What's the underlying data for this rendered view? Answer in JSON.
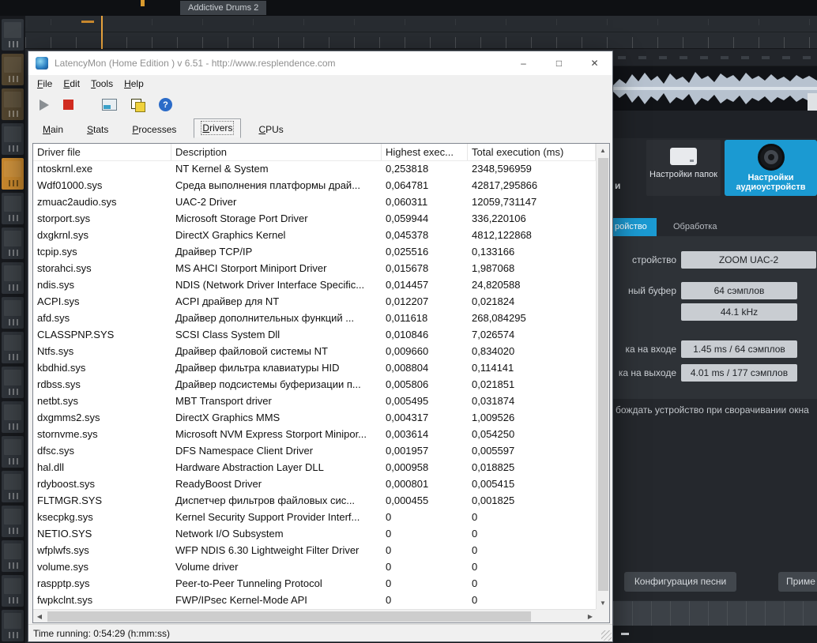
{
  "colors": {
    "accent_blue": "#1b9ad2",
    "stop_red": "#d02b20",
    "amber": "#c8882e"
  },
  "window": {
    "title": "LatencyMon  (Home Edition )  v 6.51 - http://www.resplendence.com",
    "caption_buttons": {
      "minimize": "–",
      "maximize": "□",
      "close": "✕"
    },
    "menu": [
      "File",
      "Edit",
      "Tools",
      "Help"
    ],
    "toolbar": {
      "icons": [
        "play-icon",
        "stop-icon",
        "report-icon",
        "copy-icon",
        "help-icon"
      ],
      "help_glyph": "?"
    },
    "tabs": [
      {
        "label": "Main",
        "active": false
      },
      {
        "label": "Stats",
        "active": false
      },
      {
        "label": "Processes",
        "active": false
      },
      {
        "label": "Drivers",
        "active": true
      },
      {
        "label": "CPUs",
        "active": false
      }
    ],
    "table": {
      "columns": [
        "Driver file",
        "Description",
        "Highest exec...",
        "Total execution (ms)"
      ],
      "rows": [
        [
          "ntoskrnl.exe",
          "NT Kernel & System",
          "0,253818",
          "2348,596959"
        ],
        [
          "Wdf01000.sys",
          "Среда выполнения платформы драй...",
          "0,064781",
          "42817,295866"
        ],
        [
          "zmuac2audio.sys",
          "UAC-2 Driver",
          "0,060311",
          "12059,731147"
        ],
        [
          "storport.sys",
          "Microsoft Storage Port Driver",
          "0,059944",
          "336,220106"
        ],
        [
          "dxgkrnl.sys",
          "DirectX Graphics Kernel",
          "0,045378",
          "4812,122868"
        ],
        [
          "tcpip.sys",
          "Драйвер TCP/IP",
          "0,025516",
          "0,133166"
        ],
        [
          "storahci.sys",
          "MS AHCI Storport Miniport Driver",
          "0,015678",
          "1,987068"
        ],
        [
          "ndis.sys",
          "NDIS (Network Driver Interface Specific...",
          "0,014457",
          "24,820588"
        ],
        [
          "ACPI.sys",
          "ACPI драйвер для NT",
          "0,012207",
          "0,021824"
        ],
        [
          "afd.sys",
          "Драйвер дополнительных функций ...",
          "0,011618",
          "268,084295"
        ],
        [
          "CLASSPNP.SYS",
          "SCSI Class System Dll",
          "0,010846",
          "7,026574"
        ],
        [
          "Ntfs.sys",
          "Драйвер файловой системы NT",
          "0,009660",
          "0,834020"
        ],
        [
          "kbdhid.sys",
          "Драйвер фильтра клавиатуры HID",
          "0,008804",
          "0,114141"
        ],
        [
          "rdbss.sys",
          "Драйвер подсистемы буферизации п...",
          "0,005806",
          "0,021851"
        ],
        [
          "netbt.sys",
          "MBT Transport driver",
          "0,005495",
          "0,031874"
        ],
        [
          "dxgmms2.sys",
          "DirectX Graphics MMS",
          "0,004317",
          "1,009526"
        ],
        [
          "stornvme.sys",
          "Microsoft NVM Express Storport Minipor...",
          "0,003614",
          "0,054250"
        ],
        [
          "dfsc.sys",
          "DFS Namespace Client Driver",
          "0,001957",
          "0,005597"
        ],
        [
          "hal.dll",
          "Hardware Abstraction Layer DLL",
          "0,000958",
          "0,018825"
        ],
        [
          "rdyboost.sys",
          "ReadyBoost Driver",
          "0,000801",
          "0,005415"
        ],
        [
          "FLTMGR.SYS",
          "Диспетчер фильтров файловых сис...",
          "0,000455",
          "0,001825"
        ],
        [
          "ksecpkg.sys",
          "Kernel Security Support Provider Interf...",
          "0",
          "0"
        ],
        [
          "NETIO.SYS",
          "Network I/O Subsystem",
          "0",
          "0"
        ],
        [
          "wfplwfs.sys",
          "WFP NDIS 6.30 Lightweight Filter Driver",
          "0",
          "0"
        ],
        [
          "volume.sys",
          "Volume driver",
          "0",
          "0"
        ],
        [
          "raspptp.sys",
          "Peer-to-Peer Tunneling Protocol",
          "0",
          "0"
        ],
        [
          "fwpkclnt.sys",
          "FWP/IPsec Kernel-Mode API",
          "0",
          "0"
        ]
      ]
    },
    "status": "Time running: 0:54:29  (h:mm:ss)"
  },
  "daw": {
    "top_tab": "Addictive Drums 2",
    "right_panel": {
      "folder_button": "Настройки папок",
      "audio_button": "Настройки аудиоустройств",
      "cut_label": "и",
      "tabs": [
        {
          "label": "ройство",
          "active": true
        },
        {
          "label": "Обработка",
          "active": false
        }
      ],
      "settings": [
        {
          "label": "стройство",
          "value": "ZOOM UAC-2"
        },
        {
          "label": "ный буфер",
          "value": "64 сэмплов"
        },
        {
          "label": "",
          "value": "44.1 kHz"
        },
        {
          "label": "ка на входе",
          "value": "1.45 ms / 64 сэмплов"
        },
        {
          "label": "ка на выходе",
          "value": "4.01 ms / 177 сэмплов"
        }
      ],
      "release_label": "бождать устройство при сворачивании окна",
      "song_config_button": "Конфигурация песни",
      "apply_button": "Приме"
    }
  }
}
